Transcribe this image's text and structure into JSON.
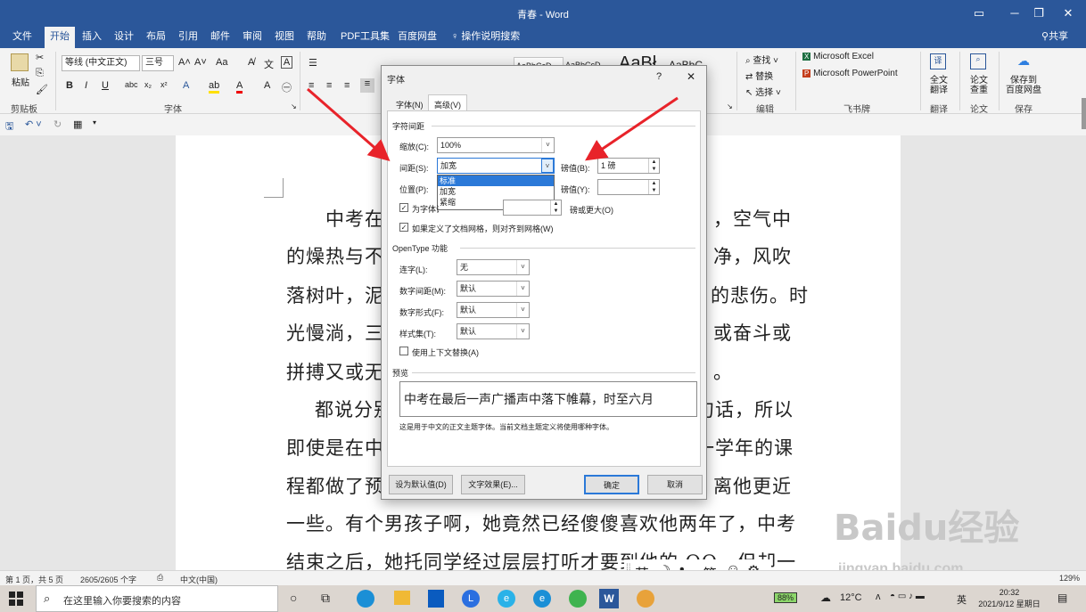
{
  "window": {
    "title": "青春 - Word",
    "share": "共享"
  },
  "tabs": [
    "文件",
    "开始",
    "插入",
    "设计",
    "布局",
    "引用",
    "邮件",
    "审阅",
    "视图",
    "帮助",
    "PDF工具集",
    "百度网盘"
  ],
  "tell_me": "操作说明搜索",
  "ribbon": {
    "paste": "粘贴",
    "font_name": "等线 (中文正文)",
    "font_size": "三号",
    "groups": {
      "clipboard": "剪贴板",
      "font": "字体",
      "edit": "编辑",
      "feishu": "飞书牌",
      "translate": "翻译",
      "paper": "论文",
      "save": "保存"
    },
    "find": "查找",
    "replace": "替换",
    "select": "选择",
    "excel": "Microsoft Excel",
    "ppt": "Microsoft PowerPoint",
    "full_translate": [
      "全文",
      "翻译"
    ],
    "paper_check": [
      "论文",
      "查重"
    ],
    "save_to": [
      "保存到",
      "百度网盘"
    ],
    "styles_preview": [
      "AaBbCcD",
      "AaBbCcD",
      "AaBł",
      "AaBbC"
    ]
  },
  "document": {
    "lines": [
      "中考在",
      "的燥热与不",
      "落树叶，泥",
      "光慢淌，三",
      "拼搏又或无",
      "都说分别",
      "即使是在中",
      "程都做了预",
      "一些。有个男孩子啊，她竟然已经傻傻喜欢他两年了，中考",
      "结束之后，她托同学经过层层打听才要到他的 QQ，但却一"
    ],
    "right_frags": [
      "，空气中",
      "净，风吹",
      "的悲伤。时",
      "或奋斗或",
      "。",
      "句话，所以",
      "一学年的课",
      "离他更近"
    ]
  },
  "dialog": {
    "title": "字体",
    "help": "?",
    "tabs": [
      "字体(N)",
      "高级(V)"
    ],
    "section_spacing": "字符间距",
    "scale_label": "缩放(C):",
    "scale_value": "100%",
    "spacing_label": "间距(S):",
    "spacing_value": "加宽",
    "spacing_options": [
      "标准",
      "加宽",
      "紧缩"
    ],
    "by1_label": "磅值(B):",
    "by1_value": "1 磅",
    "position_label": "位置(P):",
    "by2_label": "磅值(Y):",
    "kerning_label": "为字体调整字间距(K):",
    "kerning_tail": "磅或更大(O)",
    "grid_label": "如果定义了文档网格，则对齐到网格(W)",
    "section_opentype": "OpenType 功能",
    "ligature_label": "连字(L):",
    "ligature_value": "无",
    "numspacing_label": "数字间距(M):",
    "numspacing_value": "默认",
    "numform_label": "数字形式(F):",
    "numform_value": "默认",
    "styleset_label": "样式集(T):",
    "styleset_value": "默认",
    "contextual_label": "使用上下文替换(A)",
    "section_preview": "预览",
    "preview_text": "中考在最后一声广播声中落下帷幕，时至六月",
    "preview_note": "这是用于中文的正文主题字体。当前文档主题定义将使用哪种字体。",
    "btn_default": "设为默认值(D)",
    "btn_effects": "文字效果(E)...",
    "btn_ok": "确定",
    "btn_cancel": "取消"
  },
  "status": {
    "page": "第 1 页，共 5 页",
    "words": "2605/2605 个字",
    "lang": "中文(中国)",
    "zoom": "129%"
  },
  "ime": [
    "英",
    "☽",
    "•,",
    "简",
    "☺",
    "⚙"
  ],
  "taskbar": {
    "search_placeholder": "在这里输入你要搜索的内容",
    "battery": "88%",
    "weather": "12°C",
    "ime": "英",
    "time": "20:32",
    "date": "2021/9/12 星期日"
  },
  "watermark": {
    "logo": "Baidu经验",
    "url": "jingyan.baidu.com"
  }
}
